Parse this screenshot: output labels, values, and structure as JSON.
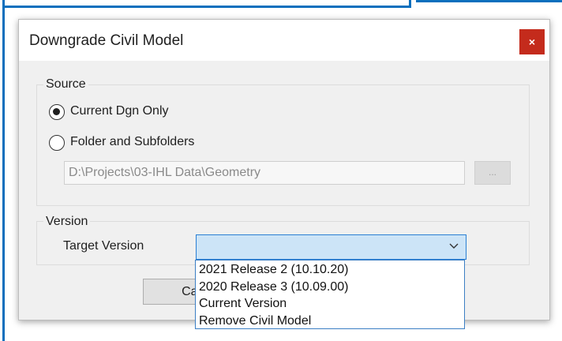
{
  "dialog": {
    "title": "Downgrade Civil Model",
    "close_glyph": "×"
  },
  "source": {
    "legend": "Source",
    "options": [
      {
        "label": "Current Dgn Only",
        "selected": true
      },
      {
        "label": "Folder and Subfolders",
        "selected": false
      }
    ],
    "path_value": "D:\\Projects\\03-IHL Data\\Geometry",
    "browse_label": "..."
  },
  "version": {
    "legend": "Version",
    "target_label": "Target Version",
    "selected_value": "",
    "dropdown_options": [
      "2021 Release 2 (10.10.20)",
      "2020 Release 3 (10.09.00)",
      "Current Version",
      "Remove Civil Model"
    ]
  },
  "buttons": {
    "cancel_label": "Cancel"
  },
  "colors": {
    "close_button": "#c42b1c",
    "frame_accent": "#0a6fbd",
    "select_highlight": "#cce4f7"
  },
  "icons": {
    "close": "close-icon",
    "dropdown": "chevron-down-icon"
  }
}
